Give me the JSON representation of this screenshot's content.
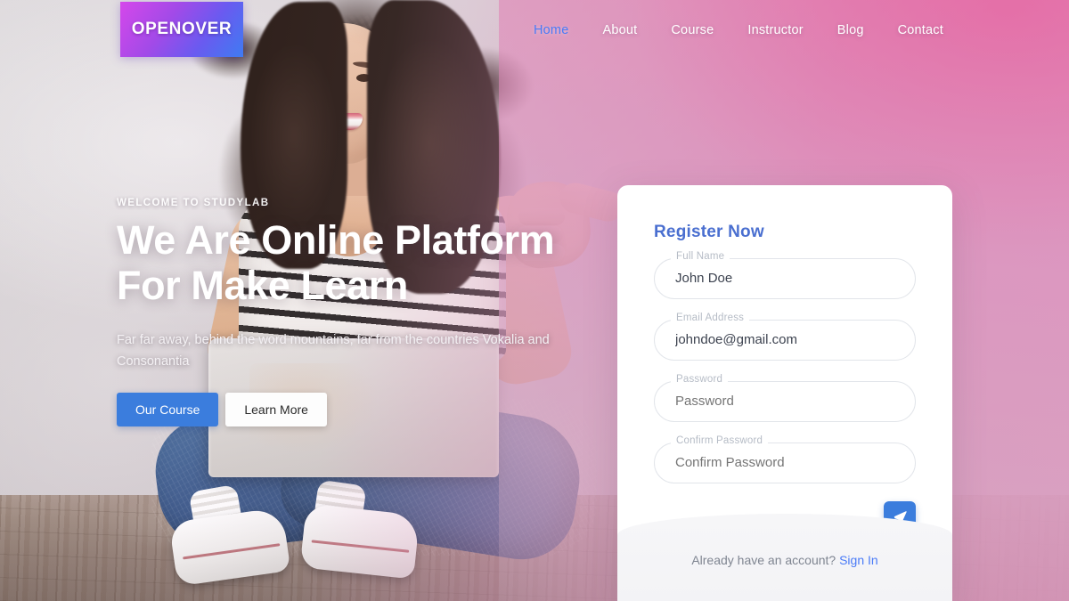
{
  "brand": {
    "name": "OPENOVER",
    "gradient_from": "#d548ea",
    "gradient_to": "#3f7bf2"
  },
  "nav": {
    "items": [
      {
        "label": "Home",
        "active": true
      },
      {
        "label": "About",
        "active": false
      },
      {
        "label": "Course",
        "active": false
      },
      {
        "label": "Instructor",
        "active": false
      },
      {
        "label": "Blog",
        "active": false
      },
      {
        "label": "Contact",
        "active": false
      }
    ],
    "active_color": "#4a7bf7",
    "inactive_color": "#ffffff"
  },
  "hero": {
    "eyebrow": "WELCOME TO STUDYLAB",
    "title_line1": "We Are Online Platform",
    "title_line2": "For Make Learn",
    "paragraph": "Far far away, behind the word mountains, far from the countries Vokalia and Consonantia",
    "primary_button": "Our Course",
    "secondary_button": "Learn More",
    "primary_button_color": "#3b7ddd"
  },
  "register": {
    "heading": "Register Now",
    "heading_color": "#4a6fd0",
    "fields": [
      {
        "label": "Full Name",
        "value": "John Doe",
        "placeholder": "Full Name",
        "filled": true
      },
      {
        "label": "Email Address",
        "value": "johndoe@gmail.com",
        "placeholder": "Email Address",
        "filled": true
      },
      {
        "label": "Password",
        "value": "",
        "placeholder": "Password",
        "filled": false
      },
      {
        "label": "Confirm Password",
        "value": "",
        "placeholder": "Confirm Password",
        "filled": false
      }
    ],
    "submit_icon": "send-paper-plane-icon",
    "submit_color": "#3b7ddd",
    "footer_text": "Already have an account?",
    "footer_link": "Sign In",
    "footer_link_color": "#4a7bf7"
  },
  "background": {
    "scene": "woman-sitting-with-laptop-photo",
    "overlay_accent": "#e95696"
  }
}
